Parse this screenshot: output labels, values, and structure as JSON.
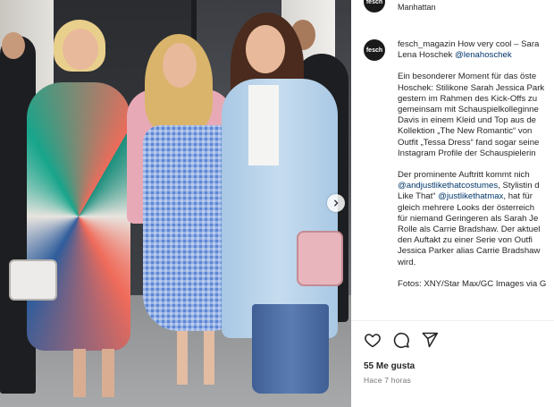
{
  "post": {
    "location": "Manhattan",
    "likes": "55 Me gusta",
    "time": "Hace 7 horas",
    "avatar_text": "fesch"
  },
  "caption": {
    "username": "fesch_magazin",
    "line1_text": " How very cool – Sara",
    "line2_text": "Lena Hoschek ",
    "line2_tag": "@lenahoschek",
    "p1": [
      "Ein besonderer Moment für das öste",
      "Hoschek: Stilikone Sarah Jessica Park",
      "gestern im Rahmen des Kick-Offs zu",
      "gemeinsam mit Schauspielkolleginne",
      "Davis in einem Kleid und Top aus de",
      "Kollektion „The New Romantic“ von",
      "Outfit „Tessa Dress“ fand sogar seine",
      "Instagram Profile der Schauspielerin"
    ],
    "p2_line1": "Der prominente Auftritt kommt nich",
    "p2_line2_tag": "@andjustlikethatcostumes",
    "p2_line2_text": ", Stylistin d",
    "p2_line3_text": "Like That“ ",
    "p2_line3_tag": "@justlikethatmax",
    "p2_line3_text2": ", hat für",
    "p2_rest": [
      "gleich mehrere Looks der österreich",
      "für niemand Geringeren als Sarah Je",
      "Rolle als Carrie Bradshaw. Der aktuel",
      "den Auftakt zu einer Serie von Outfi",
      "Jessica Parker alias Carrie Bradshaw",
      "wird."
    ],
    "p3": "Fotos: XNY/Star Max/GC Images via G"
  },
  "icons": {
    "like": "heart-icon",
    "comment": "comment-icon",
    "share": "send-icon",
    "carousel": "chevron-right-icon"
  },
  "colors": {
    "link": "#00376b",
    "text": "#262626",
    "muted": "#737373"
  }
}
